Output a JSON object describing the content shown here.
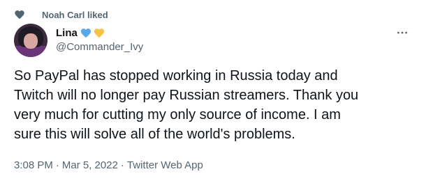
{
  "social_context": {
    "icon": "heart-icon",
    "text": "Noah Carl liked"
  },
  "author": {
    "display_name": "Lina",
    "emojis": [
      "blue-heart",
      "yellow-heart"
    ],
    "handle": "@Commander_Ivy"
  },
  "tweet": {
    "text": "So PayPal has stopped working in Russia today and\nTwitch will no longer pay Russian streamers. Thank you\nvery much for cutting my only source of income. I am\nsure this will solve all of the world's problems.",
    "time": "3:08 PM",
    "separator": "·",
    "date": "Mar 5, 2022",
    "source": "Twitter Web App"
  },
  "colors": {
    "primary_text": "#0f1419",
    "secondary_text": "#536471",
    "blue_heart": "#5aa9e6",
    "yellow_heart": "#f6c343"
  }
}
